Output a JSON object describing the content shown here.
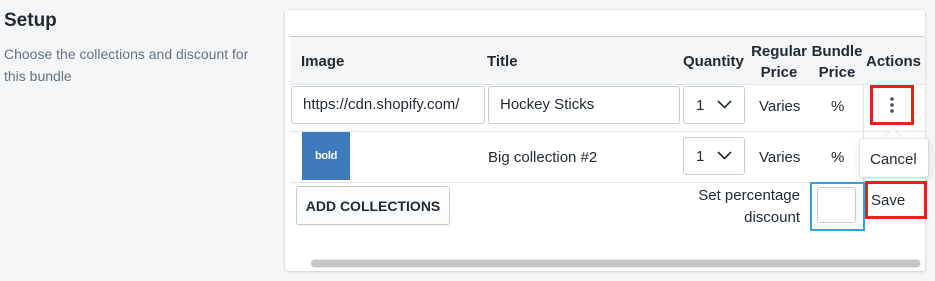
{
  "section": {
    "title": "Setup",
    "description": "Choose the collections and discount for this bundle"
  },
  "table": {
    "headers": {
      "image": "Image",
      "title": "Title",
      "quantity": "Quantity",
      "regular_price_1": "Regular",
      "regular_price_2": "Price",
      "bundle_price_1": "Bundle",
      "bundle_price_2": "Price",
      "actions": "Actions"
    },
    "rows": [
      {
        "image_url": "https://cdn.shopify.com/",
        "title": "Hockey Sticks",
        "quantity": "1",
        "regular_price": "Varies",
        "bundle_price": "%"
      },
      {
        "thumbnail_text": "bold",
        "title": "Big collection #2",
        "quantity": "1",
        "regular_price": "Varies",
        "bundle_price": "%"
      }
    ]
  },
  "actions_menu": {
    "cancel": "Cancel",
    "save": "Save"
  },
  "footer": {
    "add_collections": "ADD COLLECTIONS",
    "percentage_label": "Set percentage discount",
    "percentage_value": ""
  },
  "colors": {
    "highlight": "#e5231b",
    "focus": "#33a3dc",
    "thumbnail": "#3e7bbd"
  }
}
